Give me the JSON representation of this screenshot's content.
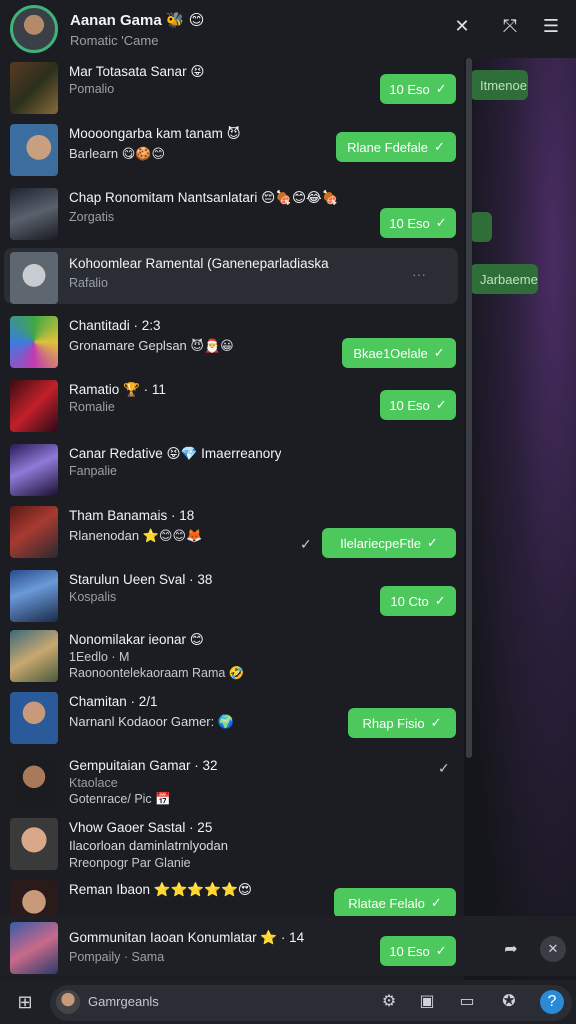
{
  "header": {
    "title": "Aanan Gama 🐝 😊",
    "subtitle": "Romatic 'Came"
  },
  "backdrop_bubbles": [
    "Itmenoe",
    "",
    "Jarbaeme"
  ],
  "chats": [
    {
      "name": "Mar Totasata Sanar 😝",
      "sub": "Pomalio",
      "button": "10 Eso"
    },
    {
      "name": "Moooongarba kam tanam 😈",
      "line2": "Barlearn 😋🍪😊",
      "button": "Rlane Fdefale"
    },
    {
      "name": "Chap Ronomitam Nantsanlatari 😔🍖😊😂🍖",
      "sub": "Zorgatis",
      "button": "10 Eso"
    },
    {
      "name": "Kohoomlear Ramental (Ganeneparladiaska",
      "sub": "Rafalio"
    },
    {
      "name": "Chantitadi · 2:3",
      "line2": "Gronamare Geplsan 😈🎅😀",
      "button": "Bkae1Oelale"
    },
    {
      "name": "Ramatio 🏆 · 11",
      "sub": "Romalie",
      "button": "10 Eso"
    },
    {
      "name": "Canar Redative 😝💎 Imaerreanory",
      "sub": "Fanpalie"
    },
    {
      "name": "Tham Banamais · 18",
      "line2": "Rlanenodan ⭐😊😊🦊",
      "button": "IlelariecpeFtle"
    },
    {
      "name": "Starulun Ueen Sval · 38",
      "sub": "Kospalis",
      "button": "10 Cto"
    },
    {
      "name": "Nonomilakar ieonar 😊",
      "line2": "1Eedlo · M",
      "sub3": "Raonoontelekaoraam Rama 🤣"
    },
    {
      "name": "Chamitan · 2/1",
      "line2": "Narnanl Kodaoor Gamer: 🌍",
      "button": "Rhap Fisio"
    },
    {
      "name": "Gempuitaian Gamar · 32",
      "sub": "Ktaolace",
      "sub3": "Gotenrace/ Pic 📅"
    },
    {
      "name": "Vhow Gaoer Sastal · 25",
      "line2": "Ilacorloan daminlatrnlyodan",
      "sub3": "Rreonpogr Par Glanie"
    },
    {
      "name": "Reman Ibaon ⭐⭐⭐⭐⭐😍",
      "button": "Rlatae Felalo"
    },
    {
      "name": "Gommunitan Iaoan Konumlatar ⭐ · 14",
      "sub": "Pompaily · Sama",
      "button": "10 Eso"
    }
  ],
  "taskbar": {
    "search_placeholder": "Gamrgeanls"
  }
}
